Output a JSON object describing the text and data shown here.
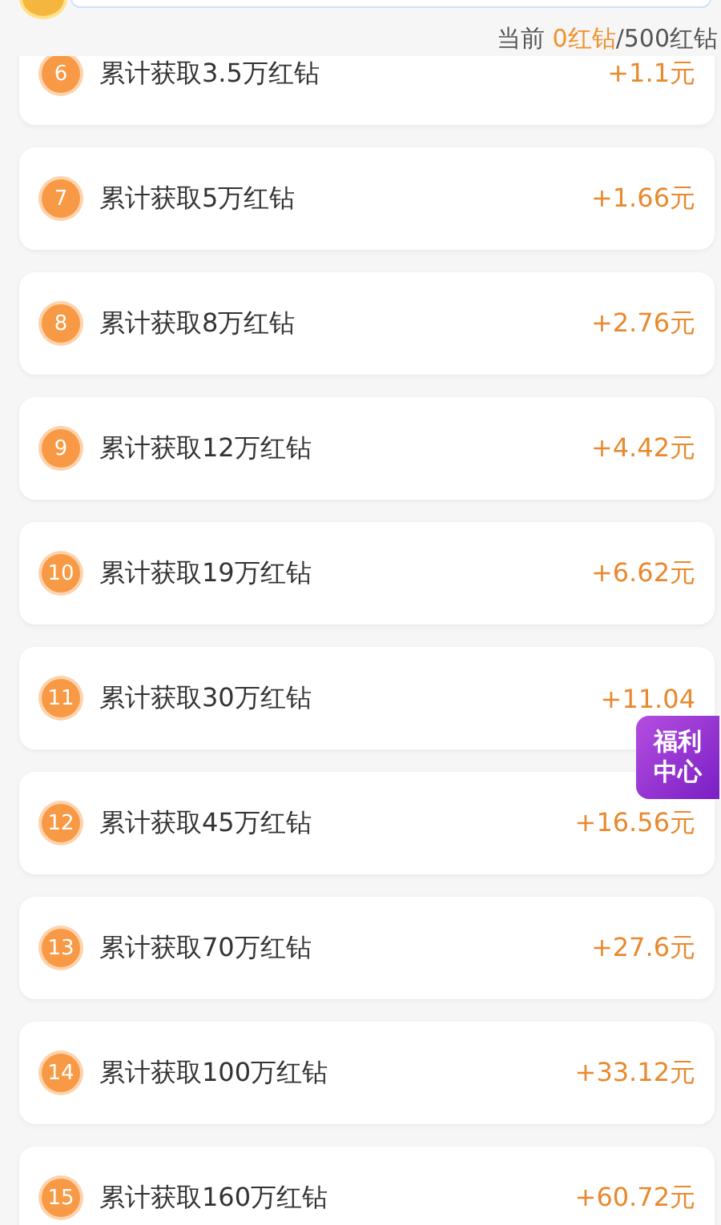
{
  "status": {
    "prefix": "当前 ",
    "current": "0红钻",
    "total": "/500红钻"
  },
  "tasks": [
    {
      "index": "6",
      "title": "累计获取3.5万红钻",
      "reward": "+1.1元"
    },
    {
      "index": "7",
      "title": "累计获取5万红钻",
      "reward": "+1.66元"
    },
    {
      "index": "8",
      "title": "累计获取8万红钻",
      "reward": "+2.76元"
    },
    {
      "index": "9",
      "title": "累计获取12万红钻",
      "reward": "+4.42元"
    },
    {
      "index": "10",
      "title": "累计获取19万红钻",
      "reward": "+6.62元"
    },
    {
      "index": "11",
      "title": "累计获取30万红钻",
      "reward": "+11.04"
    },
    {
      "index": "12",
      "title": "累计获取45万红钻",
      "reward": "+16.56元"
    },
    {
      "index": "13",
      "title": "累计获取70万红钻",
      "reward": "+27.6元"
    },
    {
      "index": "14",
      "title": "累计获取100万红钻",
      "reward": "+33.12元"
    },
    {
      "index": "15",
      "title": "累计获取160万红钻",
      "reward": "+60.72元"
    }
  ],
  "floating_badge": {
    "label": "福利中心"
  }
}
